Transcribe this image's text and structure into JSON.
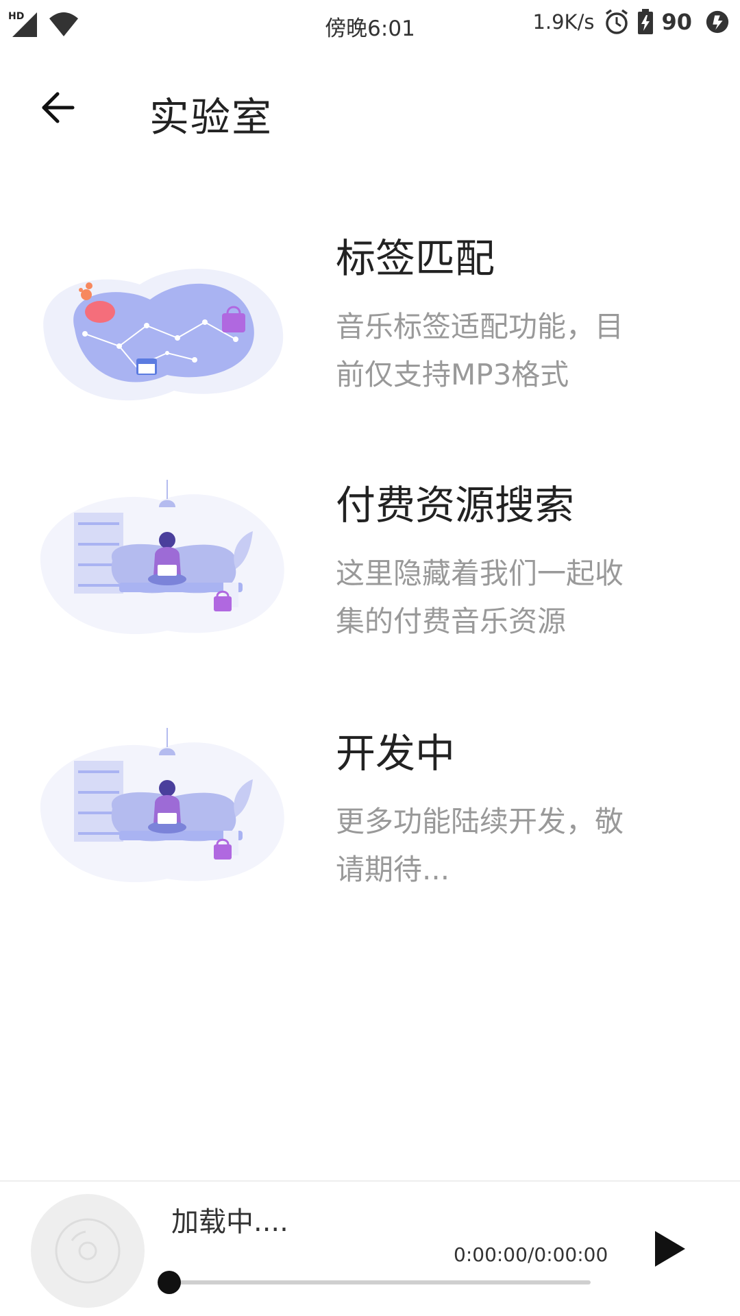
{
  "status_bar": {
    "hd_label": "HD",
    "time": "傍晚6:01",
    "net_speed": "1.9K/s",
    "battery_level": "90",
    "icons": [
      "signal-icon",
      "wifi-icon",
      "alarm-icon",
      "battery-charging-icon",
      "app-notification-icon"
    ]
  },
  "header": {
    "back_icon": "arrow-left-icon",
    "title": "实验室"
  },
  "cards": [
    {
      "title": "标签匹配",
      "desc_line1": "音乐标签适配功能，目",
      "desc_line2": "前仅支持MP3格式"
    },
    {
      "title": "付费资源搜索",
      "desc_line1": "这里隐藏着我们一起收",
      "desc_line2": "集的付费音乐资源"
    },
    {
      "title": "开发中",
      "desc_line1": "更多功能陆续开发，敬",
      "desc_line2": "请期待..."
    }
  ],
  "player": {
    "title": "加载中....",
    "time": "0:00:00/0:00:00",
    "progress_fraction": 0,
    "icons": [
      "disc-icon",
      "play-icon"
    ]
  },
  "colors": {
    "illustration_purple": "#a9b3f2",
    "illustration_bg": "#eef0fb",
    "desc_gray": "#999999",
    "title_dark": "#222222"
  }
}
